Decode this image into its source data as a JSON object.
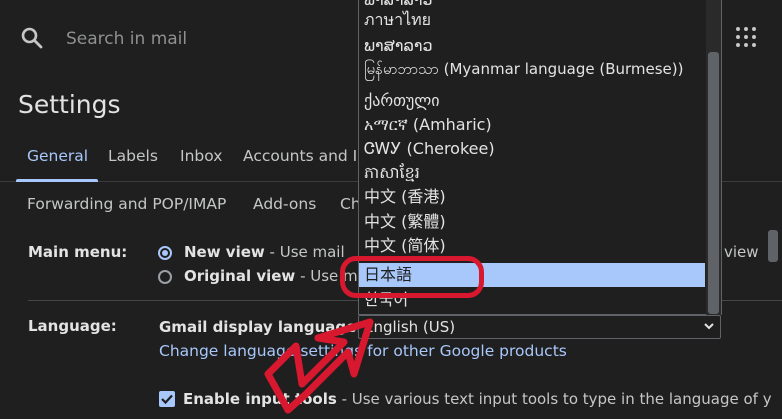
{
  "header": {
    "search_placeholder": "Search in mail"
  },
  "page_title": "Settings",
  "tabs_row1": [
    "General",
    "Labels",
    "Inbox",
    "Accounts and I"
  ],
  "tabs_row2": [
    "Forwarding and POP/IMAP",
    "Add-ons",
    "Ch"
  ],
  "main_menu": {
    "label": "Main menu:",
    "new_view": {
      "name": "New view",
      "desc": " - Use mail",
      "tail": "view"
    },
    "original_view": {
      "name": "Original view",
      "desc": " - Use ma"
    }
  },
  "language": {
    "label": "Language:",
    "display_label": "Gmail display language:",
    "selected": "English (US)",
    "change_link_a": "Change language setting",
    "change_link_b": "s for other Google products",
    "input_tools_bold": "Enable input tools",
    "input_tools_desc": " - Use various text input tools to type in the language of y"
  },
  "dropdown_items": [
    "ພາສາລາວ",
    "ภาษาไทย",
    "ພາສາລາວ",
    "မြန်မာဘာသာ (Myanmar language (Burmese))",
    "ქართული",
    "አማርኛ (Amharic)",
    "ᏣᎳᎩ (Cherokee)",
    "ភាសាខ្មែរ",
    "中文 (香港)",
    "中文 (繁體)",
    "中文 (简体)",
    "日本語",
    "한국어"
  ],
  "colors": {
    "accent": "#a8c7fa",
    "highlight": "#d8182e",
    "background": "#1f1f1f"
  }
}
